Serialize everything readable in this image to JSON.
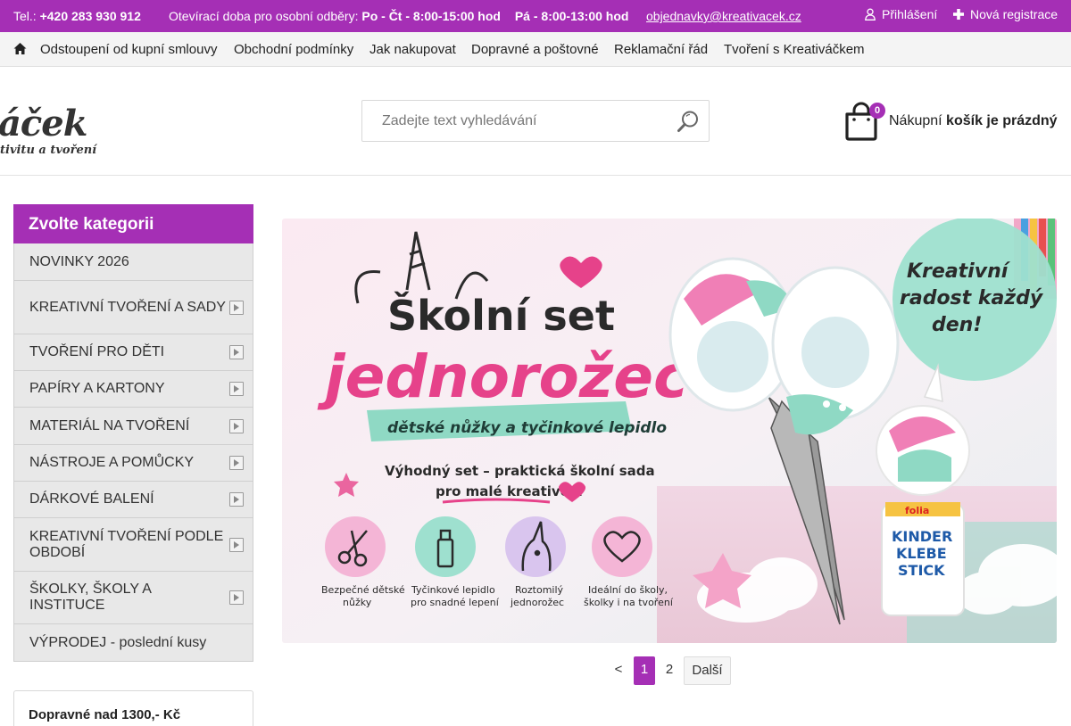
{
  "topbar": {
    "phone_label": "Tel.:",
    "phone": "+420 283 930 912",
    "hours_label": "Otevírací doba pro osobní odběry:",
    "hours_weekdays": "Po - Čt - 8:00-15:00 hod",
    "hours_friday": "Pá - 8:00-13:00 hod",
    "email": "objednavky@kreativacek.cz",
    "login": "Přihlášení",
    "register": "Nová registrace"
  },
  "nav": {
    "items": [
      "Odstoupení od kupní smlouvy",
      "Obchodní podmínky",
      "Jak nakupovat",
      "Dopravné a poštovné",
      "Reklamační řád",
      "Tvoření s Kreativáčkem"
    ]
  },
  "header": {
    "logo_text": "áček",
    "logo_tagline": "tivitu a tvoření",
    "search_placeholder": "Zadejte text vyhledávání",
    "cart_count": "0",
    "cart_label": "Nákupní",
    "cart_status": "košík je prázdný"
  },
  "sidebar": {
    "title": "Zvolte kategorii",
    "categories": [
      {
        "label": "NOVINKY 2026",
        "has_sub": false
      },
      {
        "label": "KREATIVNÍ TVOŘENÍ A SADY",
        "has_sub": true
      },
      {
        "label": "TVOŘENÍ PRO DĚTI",
        "has_sub": true
      },
      {
        "label": "PAPÍRY A KARTONY",
        "has_sub": true
      },
      {
        "label": "MATERIÁL NA TVOŘENÍ",
        "has_sub": true
      },
      {
        "label": "NÁSTROJE A POMŮCKY",
        "has_sub": true
      },
      {
        "label": "DÁRKOVÉ BALENÍ",
        "has_sub": true
      },
      {
        "label": "KREATIVNÍ TVOŘENÍ PODLE OBDOBÍ",
        "has_sub": true
      },
      {
        "label": "ŠKOLKY, ŠKOLY A INSTITUCE",
        "has_sub": true
      },
      {
        "label": "VÝPRODEJ - poslední kusy",
        "has_sub": false
      }
    ],
    "shipping_note": "Dopravné nad 1300,- Kč"
  },
  "banner": {
    "title_line1": "Školní set",
    "title_line2": "jednorožec",
    "ribbon": "dětské nůžky a tyčinkové lepidlo",
    "subtitle_line1": "Výhodný set – praktická školní sada",
    "subtitle_line2": "pro malé kreativce!",
    "badge_line1": "Kreativní",
    "badge_line2": "radost každý",
    "badge_line3": "den!",
    "features": [
      {
        "line1": "Bezpečné dětské",
        "line2": "nůžky",
        "icon": "scissors-icon"
      },
      {
        "line1": "Tyčinkové lepidlo",
        "line2": "pro snadné lepení",
        "icon": "glue-stick-icon"
      },
      {
        "line1": "Roztomilý",
        "line2": "jednorožec",
        "icon": "unicorn-icon"
      },
      {
        "line1": "Ideální do školy,",
        "line2": "školky i na tvoření",
        "icon": "heart-icon"
      }
    ],
    "glue_brand": "folia",
    "glue_line1": "KINDER",
    "glue_line2": "KLEBE",
    "glue_line3": "STICK"
  },
  "pager": {
    "prev": "<",
    "current": "1",
    "page2": "2",
    "next": "Další"
  },
  "colors": {
    "accent": "#a52fb5",
    "mint": "#8fd9c4",
    "pink": "#e6428a"
  }
}
